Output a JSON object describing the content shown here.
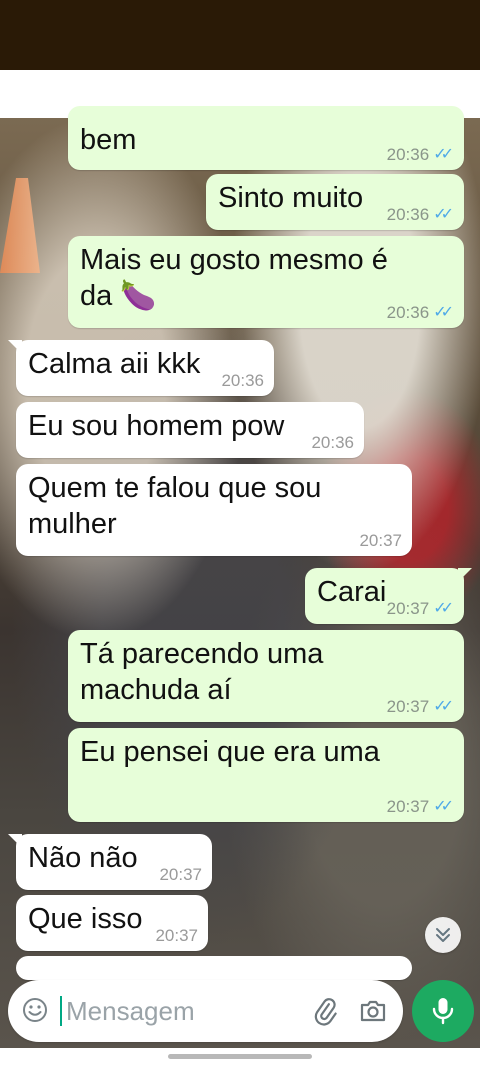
{
  "messages": [
    {
      "text": "bem",
      "time": "20:36",
      "dir": "out"
    },
    {
      "text": "Sinto muito",
      "time": "20:36",
      "dir": "out"
    },
    {
      "text": "Mais eu gosto mesmo é da 🍆",
      "time": "20:36",
      "dir": "out"
    },
    {
      "text": "Calma aii kkk",
      "time": "20:36",
      "dir": "in"
    },
    {
      "text": "Eu sou homem pow",
      "time": "20:36",
      "dir": "in"
    },
    {
      "text": "Quem te falou que sou mulher",
      "time": "20:37",
      "dir": "in"
    },
    {
      "text": "Carai",
      "time": "20:37",
      "dir": "out"
    },
    {
      "text": "Tá parecendo uma machuda aí",
      "time": "20:37",
      "dir": "out"
    },
    {
      "text": "Eu pensei que era uma",
      "time": "20:37",
      "dir": "out"
    },
    {
      "text": "Não não",
      "time": "20:37",
      "dir": "in"
    },
    {
      "text": "Que isso",
      "time": "20:37",
      "dir": "in"
    }
  ],
  "composer": {
    "placeholder": "Mensagem"
  },
  "icons": {
    "emoji": "emoji-icon",
    "attach": "paperclip-icon",
    "camera": "camera-icon",
    "mic": "mic-icon",
    "scroll": "chevron-double-down-icon",
    "read": "double-check-icon"
  },
  "colors": {
    "outgoing_bubble": "#e7fed9",
    "incoming_bubble": "#ffffff",
    "read_ticks": "#4fa9e8",
    "mic_button": "#1daa61"
  }
}
